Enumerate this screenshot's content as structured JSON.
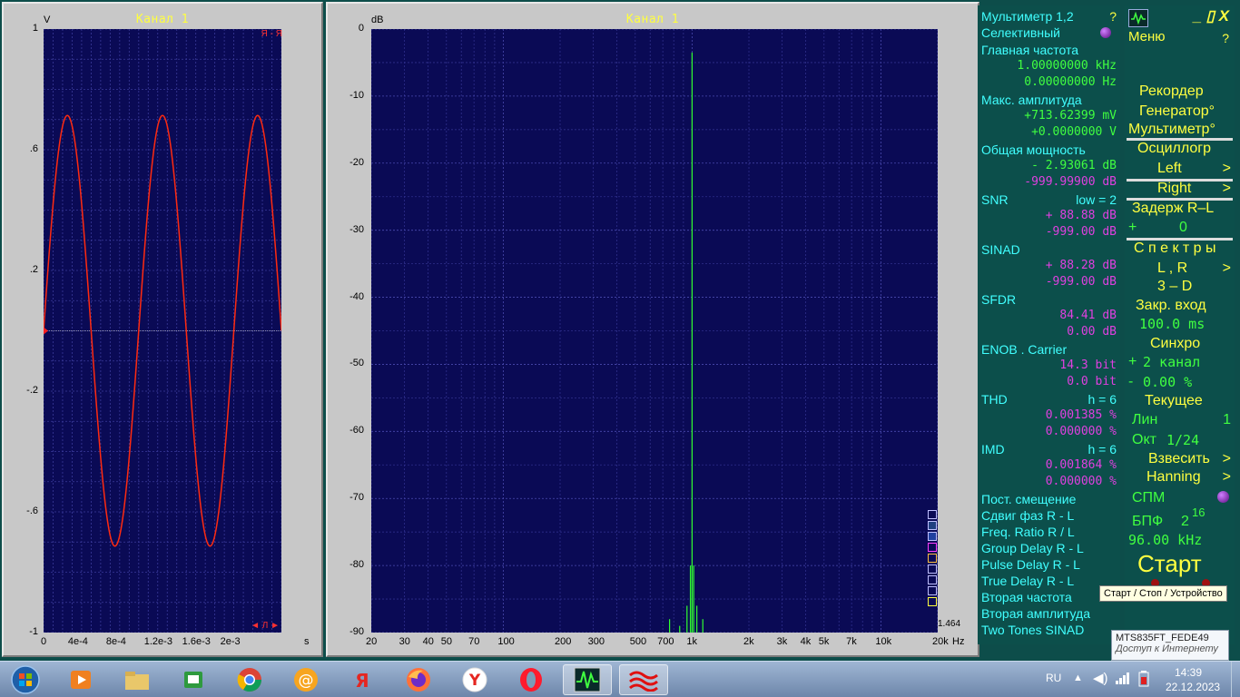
{
  "osc": {
    "title": "Канал 1",
    "y_unit": "V",
    "x_unit": "s",
    "y_ticks": [
      "1",
      ".6",
      ".2",
      "-.2",
      "-.6",
      "-1"
    ],
    "x_ticks": [
      "0",
      "4e-4",
      "8e-4",
      "1.2e-3",
      "1.6e-3",
      "2e-3"
    ],
    "top_marker": "Я - Я",
    "bottom_marker": "◄ Л ►"
  },
  "spec": {
    "title": "Канал 1",
    "y_unit": "dB",
    "x_unit": "Hz",
    "y_ticks": [
      "0",
      "-10",
      "-20",
      "-30",
      "-40",
      "-50",
      "-60",
      "-70",
      "-80",
      "-90"
    ],
    "x_ticks": [
      "20",
      "30",
      "40",
      "50",
      "70",
      "100",
      "200",
      "300",
      "500",
      "700",
      "1k",
      "2k",
      "3k",
      "4k",
      "5k",
      "7k",
      "10k",
      "20k"
    ],
    "scale_value": "1.464"
  },
  "chart_data": [
    {
      "type": "line",
      "title": "Канал 1",
      "ylabel": "V",
      "xlabel": "s",
      "xlim": [
        0,
        0.0025
      ],
      "ylim": [
        -1,
        1
      ],
      "series": [
        {
          "amplitude": 0.7136,
          "frequency_hz": 1000,
          "color": "#ff2a10"
        }
      ],
      "grid": true
    },
    {
      "type": "line",
      "title": "Канал 1",
      "ylabel": "dB",
      "xlabel": "Hz",
      "x_scale": "log",
      "xlim": [
        20,
        20000
      ],
      "ylim": [
        -90,
        0
      ],
      "series": [
        {
          "color": "#30ff30",
          "x": [
            760,
            860,
            940,
            980,
            1000,
            1020,
            1060,
            1140
          ],
          "y": [
            -88,
            -89,
            -86,
            -80,
            -3.5,
            -80,
            -86,
            -88
          ]
        }
      ],
      "grid": true
    }
  ],
  "multimeter": {
    "title": "Мультиметр 1,2",
    "help": "?",
    "mode": "Селективный",
    "main_freq_label": "Главная частота",
    "main_freq_1": "1.00000000 kHz",
    "main_freq_2": "0.00000000  Hz",
    "max_amp_label": "Макс. амплитуда",
    "max_amp_1": "+713.62399 mV",
    "max_amp_2": "+0.0000000  V",
    "power_label": "Общая мощность",
    "power_1": "-   2.93061 dB",
    "power_2": "-999.99900 dB",
    "snr_label": "SNR",
    "snr_low": "low =      2",
    "snr_1": "+ 88.88 dB",
    "snr_2": "-999.00 dB",
    "sinad_label": "SINAD",
    "sinad_1": "+ 88.28 dB",
    "sinad_2": "-999.00 dB",
    "sfdr_label": "SFDR",
    "sfdr_1": "84.41 dB",
    "sfdr_2": "0.00 dB",
    "enob_label": "ENOB . Carrier",
    "enob_1": "14.3 bit",
    "enob_2": "0.0 bit",
    "thd_label": "THD",
    "thd_h": "h =       6",
    "thd_1": "0.001385 %",
    "thd_2": "0.000000 %",
    "imd_label": "IMD",
    "imd_h": "h =       6",
    "imd_1": "0.001864 %",
    "imd_2": "0.000000 %",
    "extra": [
      "Пост. смещение",
      "Сдвиг фаз R - L",
      "Freq. Ratio  R / L",
      "Group Delay R - L",
      "Pulse Delay R - L",
      "True Delay R - L",
      "Вторая частота",
      "Вторая амплитуда",
      "Two Tones SINAD"
    ]
  },
  "control": {
    "menu": "Меню",
    "win_buttons": "_ ▯ X",
    "help": "?",
    "recorder": "Рекордер",
    "generator": "Генератор°",
    "multimeter": "Мультиметр°",
    "oscillograph": "Осциллогр",
    "left": "Left",
    "right": "Right",
    "arrow": ">",
    "delay_label": "Задерж  R–L",
    "delay_sign": "+",
    "delay_value": "0",
    "spectra": "С п е к т р ы",
    "lr": "L , R",
    "three_d": "3 – D",
    "closed_input": "Закр.  вход",
    "closed_value": "100.0 ms",
    "sync": "Синхро",
    "sync_plus": "+",
    "sync_channel": "2 канал",
    "sync_minus": "-",
    "sync_value": "0.00 %",
    "current": "Текущее",
    "lin": "Лин",
    "lin_value": "1",
    "oct": "Окт",
    "oct_value": "1/24",
    "weigh": "Взвесить",
    "hanning": "Hanning",
    "spm": "СПМ",
    "fft": "БПФ",
    "fft_base": "2",
    "fft_exp": "16",
    "sample_rate": "96.00 kHz",
    "start": "Старт"
  },
  "tooltip": "Старт / Стоп / Устройство",
  "network": {
    "name": "MTS835FT_FEDE49",
    "status": "Доступ к Интернету"
  },
  "taskbar": {
    "lang": "RU",
    "time": "14:39",
    "date": "22.12.2023",
    "icons": [
      "start-orb",
      "media-player",
      "file-explorer",
      "mail-app",
      "chrome",
      "mail-ru-agent",
      "yandex",
      "firefox",
      "yandex-browser",
      "opera",
      "spectrum-analyzer",
      "audio-app"
    ]
  }
}
